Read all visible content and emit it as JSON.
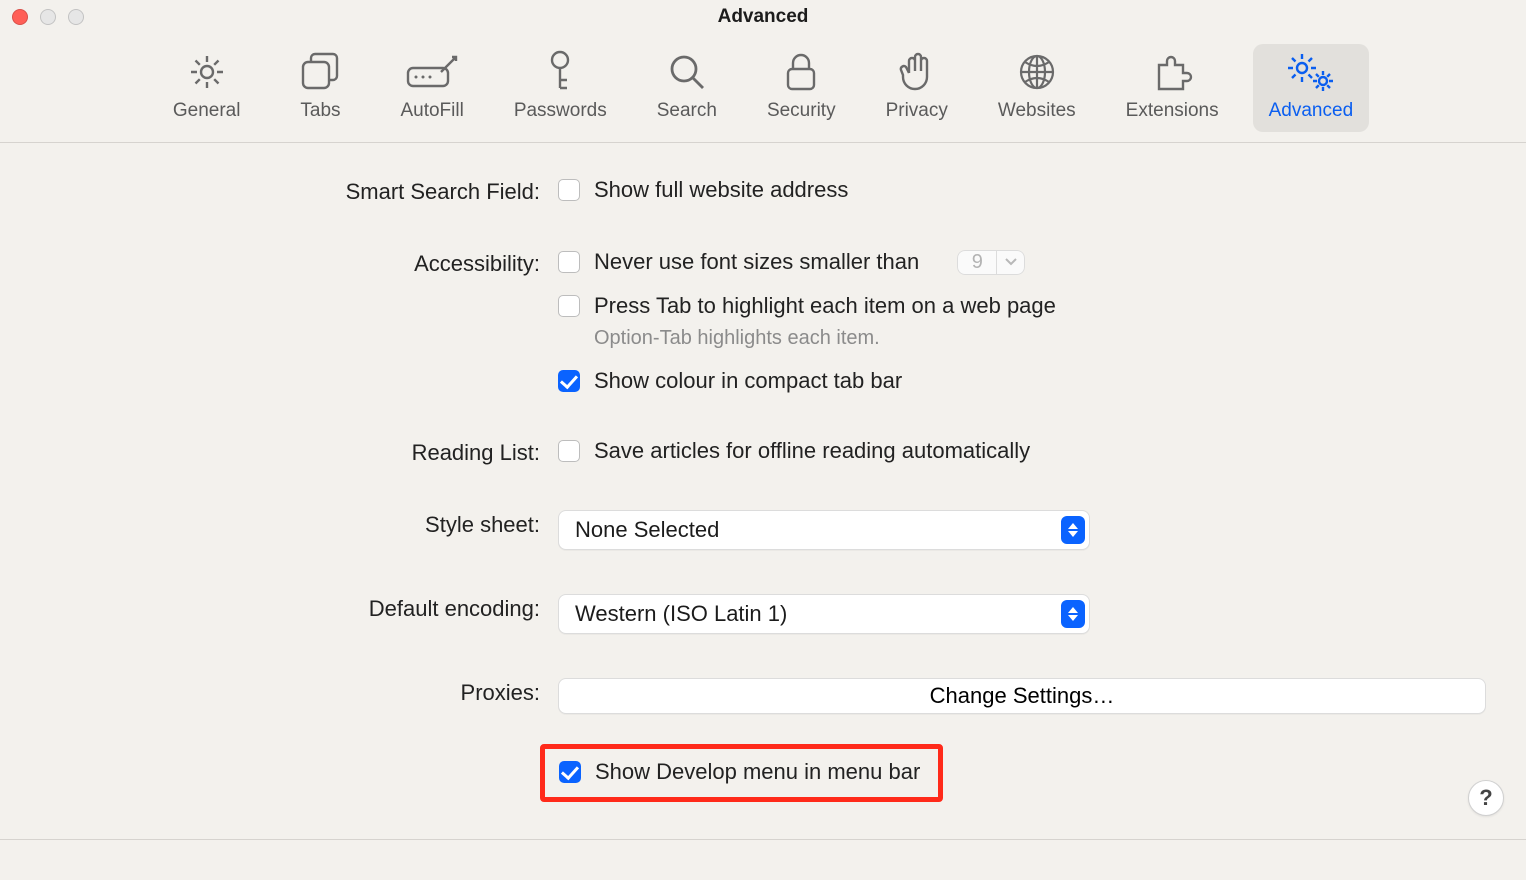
{
  "window": {
    "title": "Advanced"
  },
  "toolbar": {
    "items": [
      {
        "id": "general",
        "label": "General"
      },
      {
        "id": "tabs",
        "label": "Tabs"
      },
      {
        "id": "autofill",
        "label": "AutoFill"
      },
      {
        "id": "passwords",
        "label": "Passwords"
      },
      {
        "id": "search",
        "label": "Search"
      },
      {
        "id": "security",
        "label": "Security"
      },
      {
        "id": "privacy",
        "label": "Privacy"
      },
      {
        "id": "websites",
        "label": "Websites"
      },
      {
        "id": "extensions",
        "label": "Extensions"
      },
      {
        "id": "advanced",
        "label": "Advanced"
      }
    ],
    "active": "advanced"
  },
  "form": {
    "smart_search": {
      "label": "Smart Search Field:",
      "show_full_address": {
        "label": "Show full website address",
        "checked": false
      }
    },
    "accessibility": {
      "label": "Accessibility:",
      "min_font": {
        "label": "Never use font sizes smaller than",
        "checked": false,
        "value": "9"
      },
      "tab_highlight": {
        "label": "Press Tab to highlight each item on a web page",
        "checked": false
      },
      "tab_help": "Option-Tab highlights each item.",
      "compact_colour": {
        "label": "Show colour in compact tab bar",
        "checked": true
      }
    },
    "reading_list": {
      "label": "Reading List:",
      "offline": {
        "label": "Save articles for offline reading automatically",
        "checked": false
      }
    },
    "style_sheet": {
      "label": "Style sheet:",
      "value": "None Selected"
    },
    "default_encoding": {
      "label": "Default encoding:",
      "value": "Western (ISO Latin 1)"
    },
    "proxies": {
      "label": "Proxies:",
      "button": "Change Settings…"
    },
    "develop_menu": {
      "label": "Show Develop menu in menu bar",
      "checked": true
    }
  },
  "help_button": "?",
  "colors": {
    "accent": "#0a63ff",
    "highlight": "#ff2a1a"
  }
}
